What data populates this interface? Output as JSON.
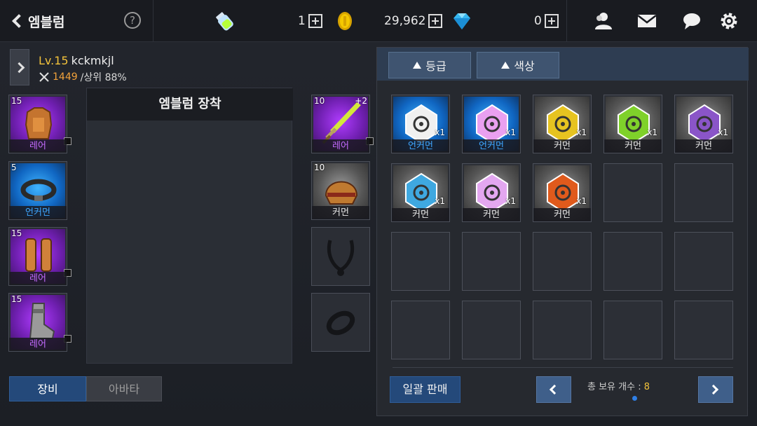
{
  "topbar": {
    "title": "엠블럼",
    "help": "?",
    "stamina_value": "1",
    "gold_value": "29,962",
    "gem_value": "0"
  },
  "character": {
    "level": "Lv.15",
    "name": "kckmkjl",
    "power": "1449",
    "rank": "/상위 88%"
  },
  "left_slots": [
    {
      "count": "15",
      "grade": "레어",
      "item": "armor"
    },
    {
      "count": "5",
      "grade": "언커먼",
      "item": "belt"
    },
    {
      "count": "15",
      "grade": "레어",
      "item": "greaves"
    },
    {
      "count": "15",
      "grade": "레어",
      "item": "boots"
    }
  ],
  "right_slots": [
    {
      "count": "10",
      "enhance": "+2",
      "grade": "레어",
      "item": "sword"
    },
    {
      "count": "10",
      "grade": "커먼",
      "item": "helmet"
    }
  ],
  "emblem_panel": {
    "title": "엠블럼 장착"
  },
  "tabs": {
    "equip": "장비",
    "avatar": "아바타"
  },
  "inventory": {
    "filters": [
      "등급",
      "색상"
    ],
    "items": [
      {
        "grade": "언커먼",
        "qty": "x1",
        "color": "#f0f0f0"
      },
      {
        "grade": "언커먼",
        "qty": "x1",
        "color": "#e9a0f0"
      },
      {
        "grade": "커먼",
        "qty": "x1",
        "color": "#e6c320"
      },
      {
        "grade": "커먼",
        "qty": "x1",
        "color": "#7fd12a"
      },
      {
        "grade": "커먼",
        "qty": "x1",
        "color": "#8a55c8"
      },
      {
        "grade": "커먼",
        "qty": "x1",
        "color": "#3fa8e0"
      },
      {
        "grade": "커먼",
        "qty": "x1",
        "color": "#e3a7f0"
      },
      {
        "grade": "커먼",
        "qty": "x1",
        "color": "#e05a1c"
      }
    ],
    "bulk_sell": "일괄 판매",
    "total_label": "총 보유 개수 : ",
    "total_count": "8"
  }
}
